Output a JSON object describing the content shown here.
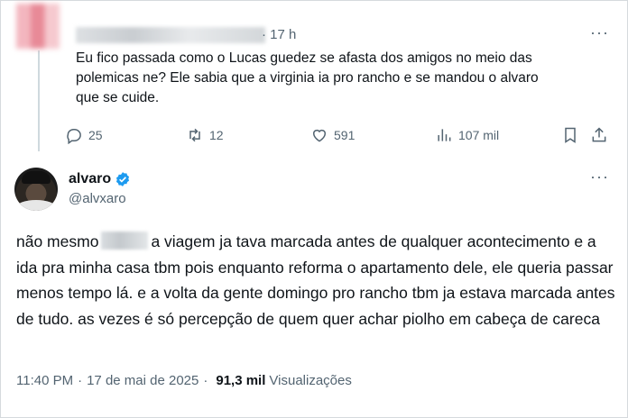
{
  "colors": {
    "text": "#0f1419",
    "secondary": "#536471",
    "verified": "#1d9bf0"
  },
  "parent_tweet": {
    "time": "· 17 h",
    "more": "···",
    "text_lines": [
      "Eu fico passada como o Lucas guedez se afasta dos amigos no meio das",
      "polemicas ne? Ele sabia que a virginia ia pro rancho e se mandou o alvaro",
      "que se cuide."
    ],
    "actions": {
      "replies": "25",
      "reposts": "12",
      "likes": "591",
      "views": "107 mil"
    }
  },
  "reply_tweet": {
    "name": "alvaro",
    "handle": "@alvxaro",
    "more": "···",
    "text_start": "não mesmo",
    "text_rest": "a viagem ja tava marcada antes de qualquer acontecimento e a ida pra minha casa tbm pois enquanto reforma o apartamento dele, ele queria passar menos tempo lá. e a volta da gente domingo pro rancho tbm ja estava marcada antes de tudo. as vezes é só percepção de quem quer achar piolho em cabeça de careca",
    "meta": {
      "time": "11:40 PM",
      "date": "17 de mai de 2025",
      "views_count": "91,3 mil",
      "views_label": "Visualizações"
    }
  }
}
